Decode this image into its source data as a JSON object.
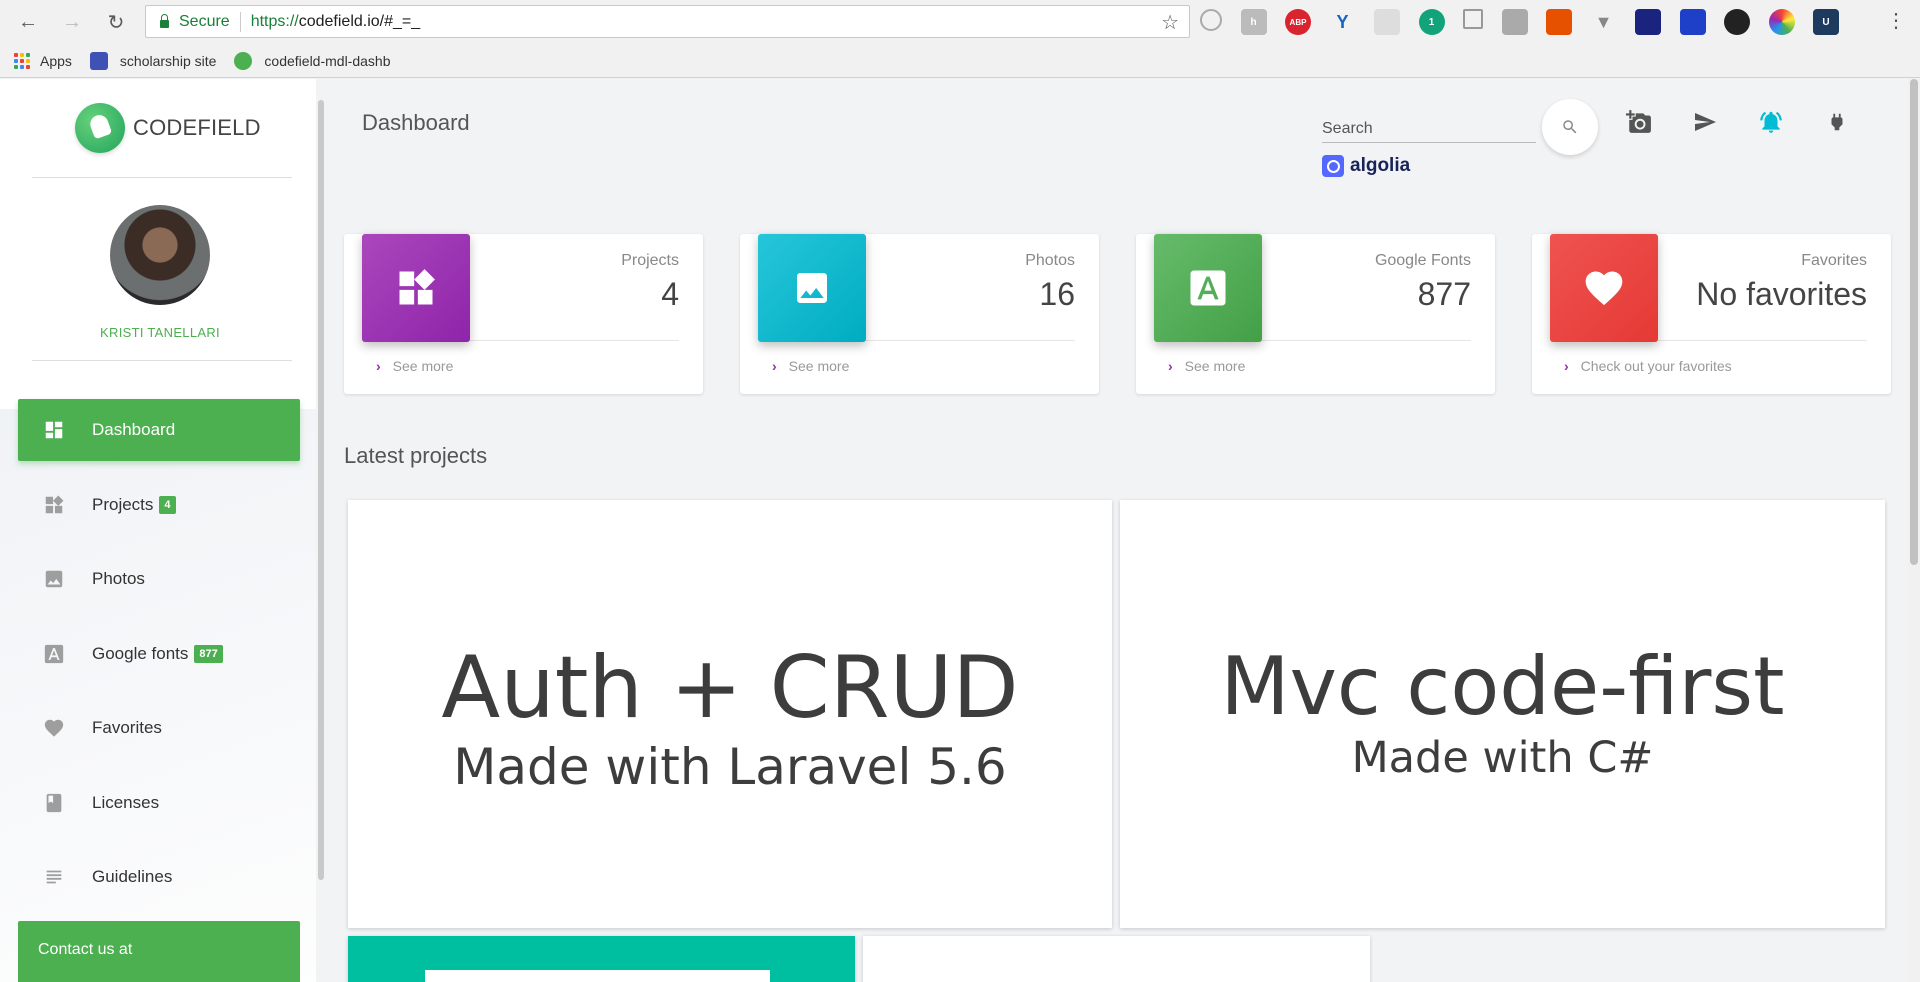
{
  "browser": {
    "secure_label": "Secure",
    "url_scheme": "https://",
    "url_rest": "codefield.io/#_=_",
    "bookmarks": [
      {
        "label": "Apps"
      },
      {
        "label": "scholarship site"
      },
      {
        "label": "codefield-mdl-dashb"
      }
    ]
  },
  "sidebar": {
    "logo_text": "CODEFIELD",
    "username": "KRISTI TANELLARI",
    "items": [
      {
        "label": "Dashboard",
        "icon": "dashboard-icon",
        "active": true
      },
      {
        "label": "Projects",
        "icon": "widgets-icon",
        "badge": "4"
      },
      {
        "label": "Photos",
        "icon": "image-icon"
      },
      {
        "label": "Google fonts",
        "icon": "font-icon",
        "badge": "877"
      },
      {
        "label": "Favorites",
        "icon": "heart-icon"
      },
      {
        "label": "Licenses",
        "icon": "book-icon"
      },
      {
        "label": "Guidelines",
        "icon": "subject-icon"
      }
    ],
    "contact_label": "Contact us at"
  },
  "header": {
    "title": "Dashboard",
    "search_placeholder": "Search",
    "algolia_label": "algolia"
  },
  "stats": [
    {
      "label": "Projects",
      "value": "4",
      "link": "See more",
      "color": "#9c27b0",
      "icon": "widgets-icon"
    },
    {
      "label": "Photos",
      "value": "16",
      "link": "See more",
      "color": "#00bcd4",
      "icon": "image-icon"
    },
    {
      "label": "Google Fonts",
      "value": "877",
      "link": "See more",
      "color": "#4caf50",
      "icon": "font-icon"
    },
    {
      "label": "Favorites",
      "value": "No favorites",
      "link": "Check out your favorites",
      "color": "#f44336",
      "icon": "heart-icon"
    }
  ],
  "latest": {
    "title": "Latest projects",
    "projects": [
      {
        "title": "Auth + CRUD",
        "subtitle": "Made with Laravel 5.6"
      },
      {
        "title": "Mvc code-first",
        "subtitle": "Made with C#"
      }
    ]
  },
  "colors": {
    "accent": "#4caf50",
    "teal_card": "#00bfa0"
  }
}
